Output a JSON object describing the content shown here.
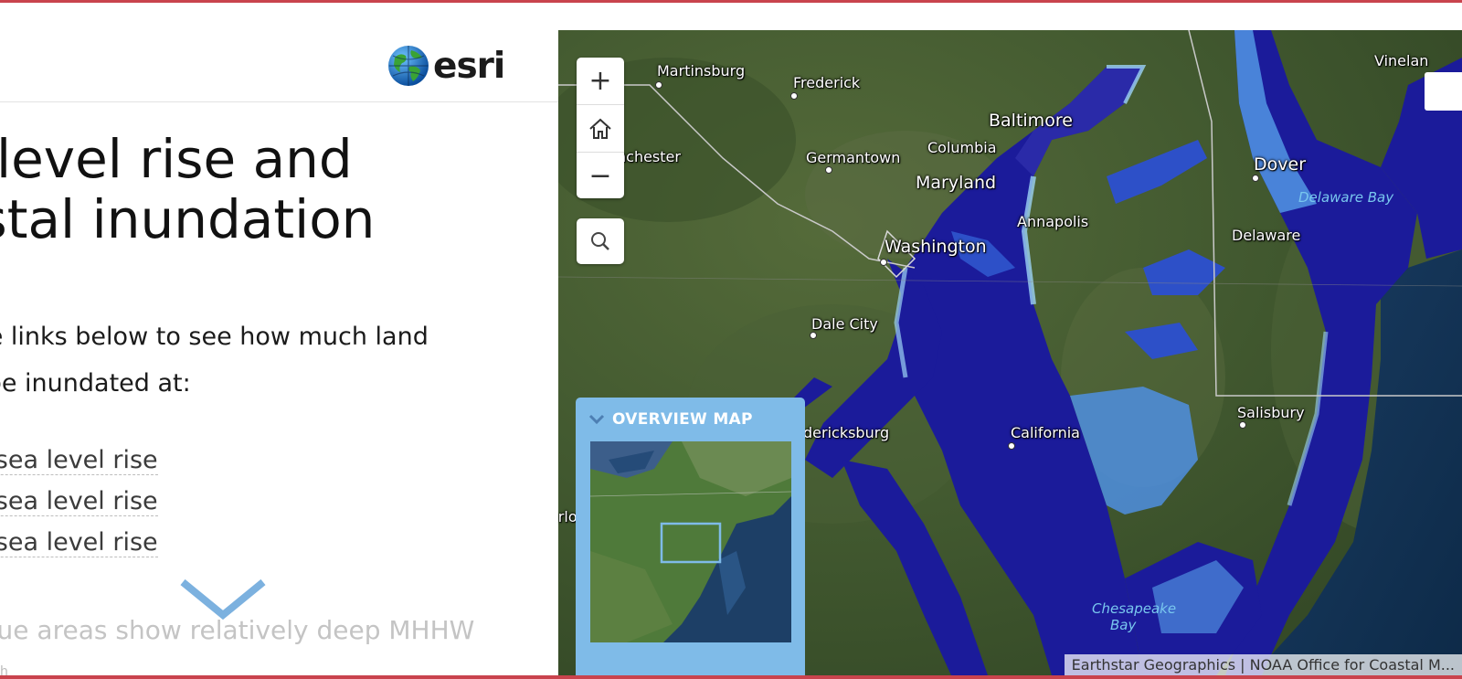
{
  "story": {
    "brand": "esri",
    "title_lines": [
      "a level rise and",
      "astal inundation"
    ],
    "intro_lines": [
      "the links below to see how much land",
      "d be inundated at:"
    ],
    "links": [
      {
        "label": "t of sea level rise"
      },
      {
        "label": "t of sea level rise"
      },
      {
        "label": "t of sea level rise"
      }
    ],
    "faded_text": "blue areas show relatively deep MHHW",
    "bottom_text": "h"
  },
  "map": {
    "zoom_in_symbol": "+",
    "zoom_out_symbol": "−",
    "places": {
      "martinsburg": "Martinsburg",
      "frederick": "Frederick",
      "baltimore": "Baltimore",
      "winchester": "nchester",
      "germantown": "Germantown",
      "columbia": "Columbia",
      "maryland": "Maryland",
      "annapolis": "Annapolis",
      "washington": "Washington",
      "dale_city": "Dale City",
      "fredericksburg": "dericksburg",
      "california": "California",
      "charlottesville": "arlo",
      "dover": "Dover",
      "delaware_bay": "Delaware Bay",
      "delaware": "Delaware",
      "salisbury": "Salisbury",
      "vineland": "Vinelan",
      "chesapeake": "Chesapeake",
      "bay": "Bay"
    },
    "overview": {
      "title": "OVERVIEW MAP"
    },
    "attribution": "Earthstar Geographics | NOAA Office for Coastal M..."
  },
  "colors": {
    "accent_border": "#c9434d",
    "deep_water": "#1a1a8c",
    "shallow_water": "#4f8fe0",
    "overview_header": "#7fbbe8"
  }
}
